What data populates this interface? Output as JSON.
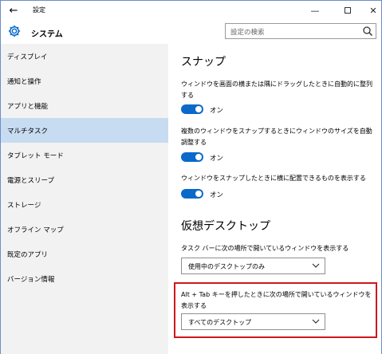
{
  "window": {
    "title": "設定"
  },
  "header": {
    "app_title": "システム",
    "search_placeholder": "設定の検索"
  },
  "sidebar": {
    "items": [
      {
        "label": "ディスプレイ",
        "active": false
      },
      {
        "label": "通知と操作",
        "active": false
      },
      {
        "label": "アプリと機能",
        "active": false
      },
      {
        "label": "マルチタスク",
        "active": true
      },
      {
        "label": "タブレット モード",
        "active": false
      },
      {
        "label": "電源とスリープ",
        "active": false
      },
      {
        "label": "ストレージ",
        "active": false
      },
      {
        "label": "オフライン マップ",
        "active": false
      },
      {
        "label": "既定のアプリ",
        "active": false
      },
      {
        "label": "バージョン情報",
        "active": false
      }
    ]
  },
  "main": {
    "snap": {
      "heading": "スナップ",
      "options": [
        {
          "description": "ウィンドウを画面の横または隅にドラッグしたときに自動的に整列する",
          "state": "オン"
        },
        {
          "description": "複数のウィンドウをスナップするときにウィンドウのサイズを自動調整する",
          "state": "オン"
        },
        {
          "description": "ウィンドウをスナップしたときに横に配置できるものを表示する",
          "state": "オン"
        }
      ]
    },
    "virtual_desktops": {
      "heading": "仮想デスクトップ",
      "taskbar_label": "タスク バーに次の場所で開いているウィンドウを表示する",
      "taskbar_value": "使用中のデスクトップのみ",
      "alttab_label": "Alt + Tab キーを押したときに次の場所で開いているウィンドウを表示する",
      "alttab_value": "すべてのデスクトップ"
    }
  },
  "colors": {
    "accent": "#0a69c9",
    "active_nav": "#c7dcf1",
    "highlight": "#d0161e"
  }
}
